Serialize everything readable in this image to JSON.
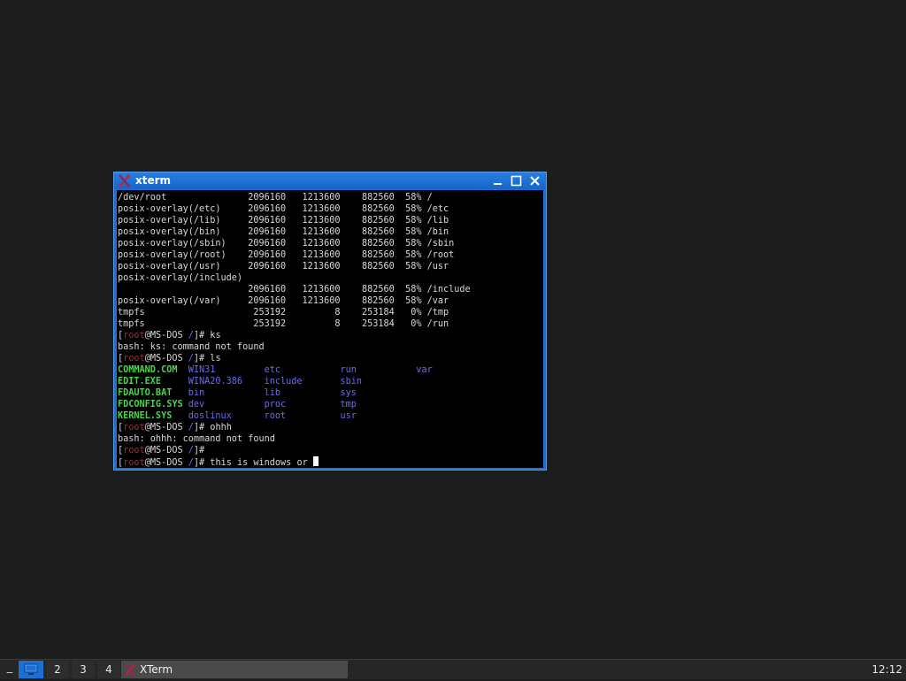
{
  "window": {
    "title": "xterm",
    "icon": "x-logo-icon"
  },
  "terminal": {
    "lines": [
      [
        {
          "t": "/dev/root               2096160   1213600    882560  58% /"
        }
      ],
      [
        {
          "t": "posix-overlay(/etc)     2096160   1213600    882560  58% /etc"
        }
      ],
      [
        {
          "t": "posix-overlay(/lib)     2096160   1213600    882560  58% /lib"
        }
      ],
      [
        {
          "t": "posix-overlay(/bin)     2096160   1213600    882560  58% /bin"
        }
      ],
      [
        {
          "t": "posix-overlay(/sbin)    2096160   1213600    882560  58% /sbin"
        }
      ],
      [
        {
          "t": "posix-overlay(/root)    2096160   1213600    882560  58% /root"
        }
      ],
      [
        {
          "t": "posix-overlay(/usr)     2096160   1213600    882560  58% /usr"
        }
      ],
      [
        {
          "t": "posix-overlay(/include)"
        }
      ],
      [
        {
          "t": "                        2096160   1213600    882560  58% /include"
        }
      ],
      [
        {
          "t": "posix-overlay(/var)     2096160   1213600    882560  58% /var"
        }
      ],
      [
        {
          "t": "tmpfs                    253192         8    253184   0% /tmp"
        }
      ],
      [
        {
          "t": "tmpfs                    253192         8    253184   0% /run"
        }
      ],
      [
        {
          "t": "["
        },
        {
          "t": "root",
          "c": "user"
        },
        {
          "t": "@MS-DOS "
        },
        {
          "t": "/",
          "c": "blue"
        },
        {
          "t": "]# ks"
        }
      ],
      [
        {
          "t": "bash: ks: command not found"
        }
      ],
      [
        {
          "t": "["
        },
        {
          "t": "root",
          "c": "user"
        },
        {
          "t": "@MS-DOS "
        },
        {
          "t": "/",
          "c": "blue"
        },
        {
          "t": "]# ls"
        }
      ],
      [
        {
          "t": "COMMAND.COM  ",
          "c": "green"
        },
        {
          "t": "WIN31         etc           run           var",
          "c": "blue"
        }
      ],
      [
        {
          "t": "EDIT.EXE     ",
          "c": "green"
        },
        {
          "t": "WINA20.386    include       sbin",
          "c": "blue"
        }
      ],
      [
        {
          "t": "FDAUTO.BAT   ",
          "c": "green"
        },
        {
          "t": "bin           lib           sys",
          "c": "blue"
        }
      ],
      [
        {
          "t": "FDCONFIG.SYS ",
          "c": "green"
        },
        {
          "t": "dev           proc          tmp",
          "c": "blue"
        }
      ],
      [
        {
          "t": "KERNEL.SYS   ",
          "c": "green"
        },
        {
          "t": "doslinux      root          usr",
          "c": "blue"
        }
      ],
      [
        {
          "t": "["
        },
        {
          "t": "root",
          "c": "user"
        },
        {
          "t": "@MS-DOS "
        },
        {
          "t": "/",
          "c": "blue"
        },
        {
          "t": "]# ohhh"
        }
      ],
      [
        {
          "t": "bash: ohhh: command not found"
        }
      ],
      [
        {
          "t": "["
        },
        {
          "t": "root",
          "c": "user"
        },
        {
          "t": "@MS-DOS "
        },
        {
          "t": "/",
          "c": "blue"
        },
        {
          "t": "]#"
        }
      ],
      [
        {
          "t": "["
        },
        {
          "t": "root",
          "c": "user"
        },
        {
          "t": "@MS-DOS "
        },
        {
          "t": "/",
          "c": "blue"
        },
        {
          "t": "]# this is windows or "
        },
        {
          "cursor": true
        }
      ]
    ]
  },
  "taskbar": {
    "menu_glyph": "_",
    "workspaces": [
      "2",
      "3",
      "4"
    ],
    "task_label": "XTerm",
    "clock": "12:12"
  },
  "colors": {
    "window_border": "#1f6ed4",
    "ls_green": "#4cd34c",
    "ls_blue": "#6a6af0",
    "prompt_user": "#8a3a3a"
  }
}
